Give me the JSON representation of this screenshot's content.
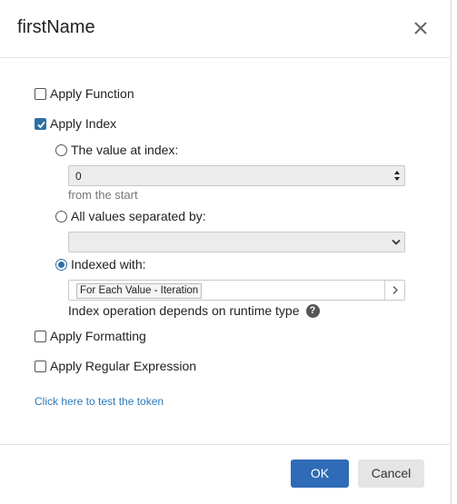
{
  "dialog": {
    "title": "firstName",
    "close_icon": "close-icon"
  },
  "options": {
    "apply_function": {
      "label": "Apply Function",
      "checked": false
    },
    "apply_index": {
      "label": "Apply Index",
      "checked": true
    },
    "value_at_index": {
      "label": "The value at index:",
      "selected": false,
      "value": "0",
      "hint": "from the start"
    },
    "all_values_separated": {
      "label": "All values separated by:",
      "selected": false,
      "value": ""
    },
    "indexed_with": {
      "label": "Indexed with:",
      "selected": true,
      "tag": "For Each Value - Iteration",
      "note": "Index operation depends on runtime type"
    },
    "apply_formatting": {
      "label": "Apply Formatting",
      "checked": false
    },
    "apply_regex": {
      "label": "Apply Regular Expression",
      "checked": false
    }
  },
  "test_link": "Click here to test the token",
  "buttons": {
    "ok": "OK",
    "cancel": "Cancel"
  },
  "colors": {
    "accent": "#2f6bb6",
    "link": "#2b79b9"
  }
}
